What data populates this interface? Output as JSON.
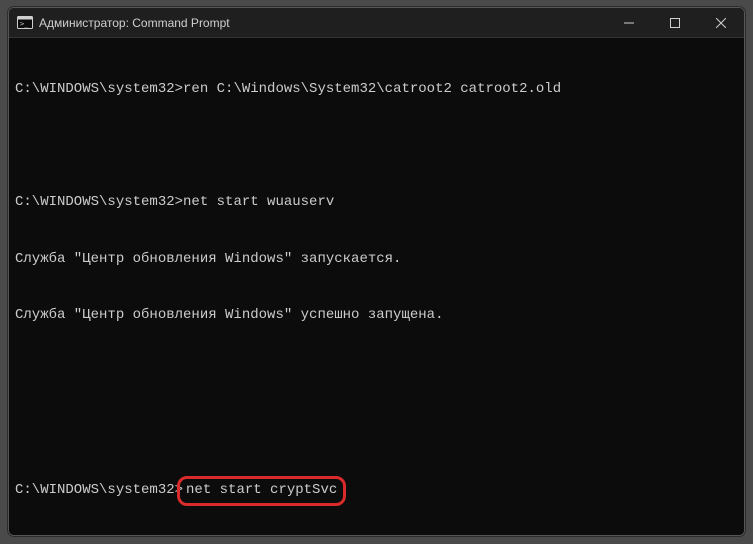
{
  "window": {
    "title": "Администратор: Command Prompt"
  },
  "terminal": {
    "lines": [
      {
        "prompt": "C:\\WINDOWS\\system32>",
        "command": "ren C:\\Windows\\System32\\catroot2 catroot2.old"
      },
      {
        "text": ""
      },
      {
        "prompt": "C:\\WINDOWS\\system32>",
        "command": "net start wuauserv"
      },
      {
        "text": "Служба \"Центр обновления Windows\" запускается."
      },
      {
        "text": "Служба \"Центр обновления Windows\" успешно запущена."
      },
      {
        "text": ""
      },
      {
        "text": ""
      },
      {
        "prompt": "C:\\WINDOWS\\system32>",
        "command": "net start cryptSvc",
        "highlighted": true
      }
    ]
  }
}
